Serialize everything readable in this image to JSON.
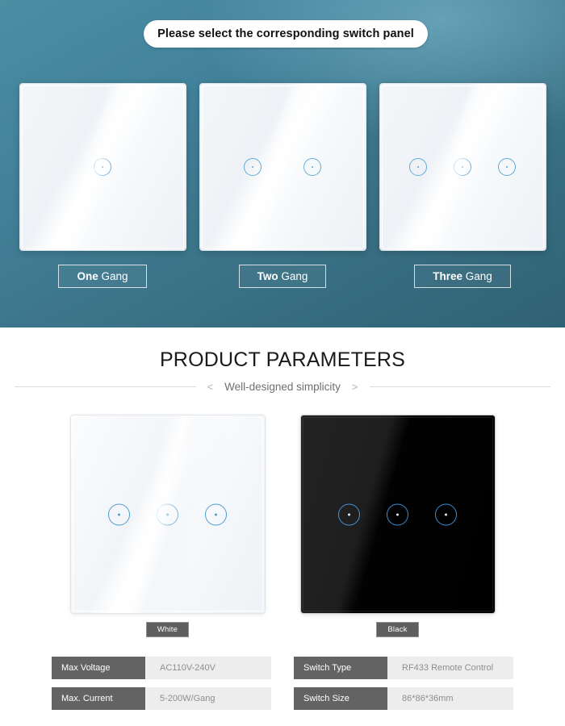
{
  "hero": {
    "prompt": "Please select the corresponding switch panel",
    "options": [
      {
        "id": "one-gang",
        "label_strong": "One",
        "label_rest": " Gang",
        "buttons": 1
      },
      {
        "id": "two-gang",
        "label_strong": "Two",
        "label_rest": " Gang",
        "buttons": 2
      },
      {
        "id": "three-gang",
        "label_strong": "Three",
        "label_rest": " Gang",
        "buttons": 3
      }
    ],
    "background_color": "#3b7287"
  },
  "parameters": {
    "title": "PRODUCT PARAMETERS",
    "subtitle": "Well-designed simplicity",
    "chevron_left": "<",
    "chevron_right": ">",
    "products": [
      {
        "id": "white-panel",
        "color_label": "White",
        "buttons": 3
      },
      {
        "id": "black-panel",
        "color_label": "Black",
        "buttons": 3
      }
    ],
    "specs_left": [
      {
        "key": "Max Voltage",
        "value": "AC110V-240V"
      },
      {
        "key": "Max. Current",
        "value": "5-200W/Gang"
      }
    ],
    "specs_right": [
      {
        "key": "Switch Type",
        "value": "RF433 Remote Control"
      },
      {
        "key": "Switch Size",
        "value": "86*86*36mm"
      }
    ]
  }
}
